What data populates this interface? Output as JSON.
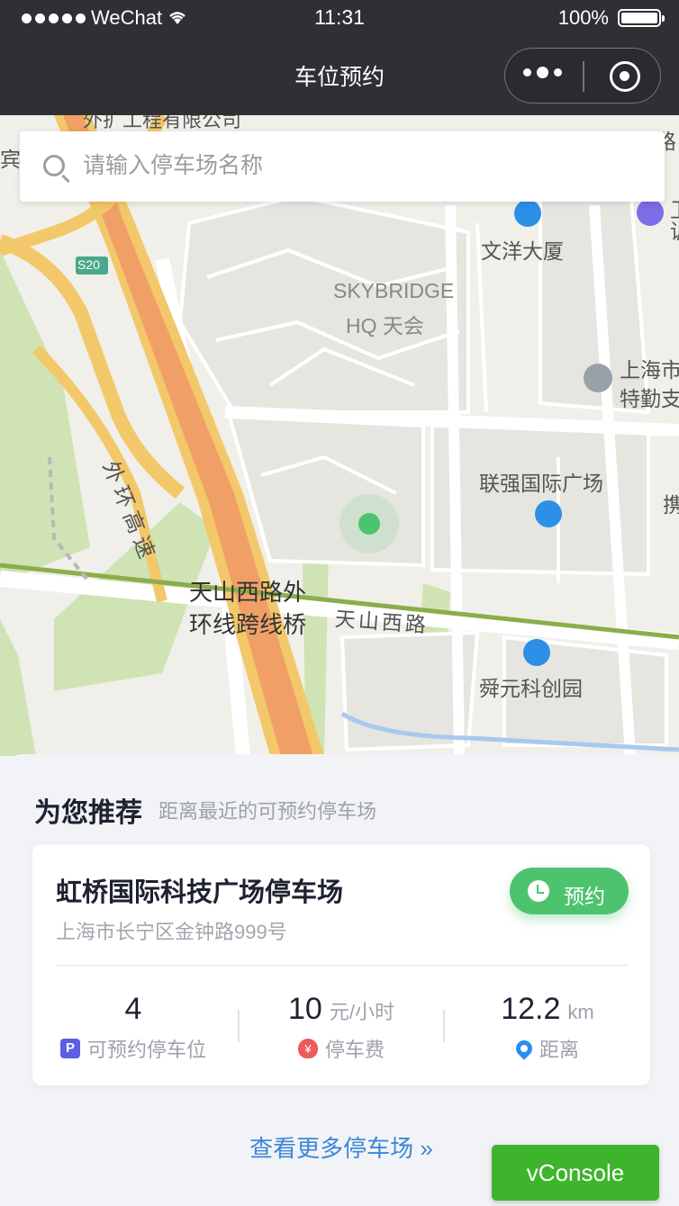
{
  "status_bar": {
    "carrier": "WeChat",
    "time": "11:31",
    "battery": "100%",
    "battery_level": 1.0
  },
  "nav": {
    "title": "车位预约"
  },
  "search": {
    "placeholder": "请输入停车场名称"
  },
  "map": {
    "labels": [
      "外环高速",
      "SKYBRIDGE",
      "HQ 天会",
      "文洋大厦",
      "上海市",
      "特勤支",
      "联强国际广场",
      "天山西路外",
      "环线跨线桥",
      "天山西路",
      "舜元科创园",
      "S20",
      "外扩工程有限公司",
      "携",
      "路",
      "卫",
      "训",
      "宾"
    ],
    "colors": {
      "expressway": "#f0a066",
      "expressway_edge": "#f3c86a",
      "green": "#cfe3b5",
      "rail": "#8bad4a",
      "water": "#a9c8f0",
      "location": "#4ec36e"
    }
  },
  "recommend": {
    "title": "为您推荐",
    "subtitle": "距离最近的可预约停车场",
    "card": {
      "name": "虹桥国际科技广场停车场",
      "address": "上海市长宁区金钟路999号",
      "book_label": "预约",
      "available": {
        "value": "4",
        "label": "可预约停车位",
        "icon": "P"
      },
      "fee": {
        "value": "10",
        "unit": "元/小时",
        "label": "停车费",
        "icon": "¥"
      },
      "distance": {
        "value": "12.2",
        "unit": "km",
        "label": "距离"
      }
    },
    "more_label": "查看更多停车场",
    "more_arrow": "»"
  },
  "vconsole": {
    "label": "vConsole"
  }
}
